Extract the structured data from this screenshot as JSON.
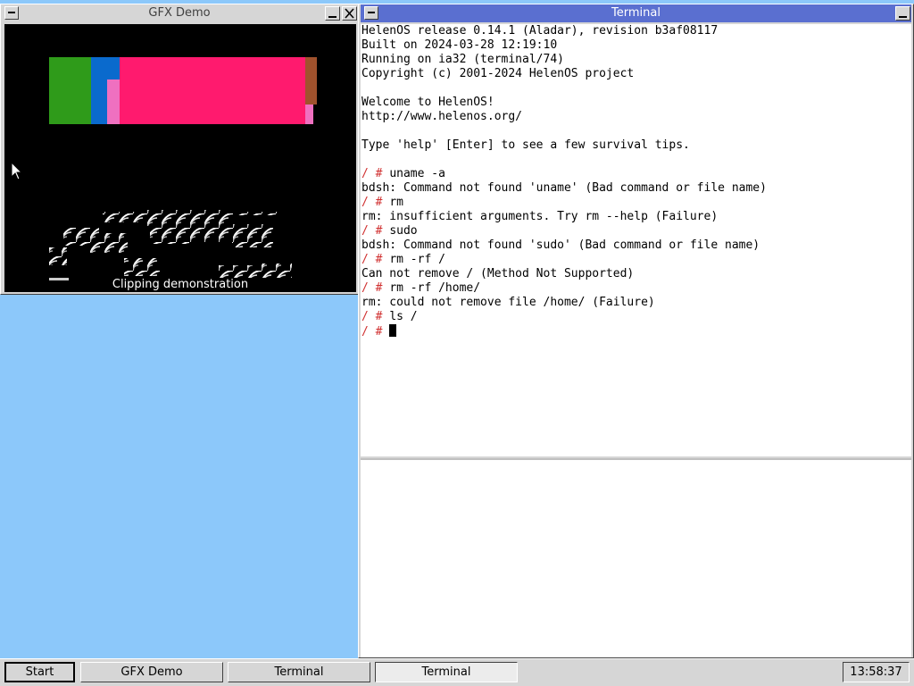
{
  "desktop": {
    "background_color": "#8cc8fa"
  },
  "gfx_window": {
    "title": "GFX Demo",
    "caption": "Clipping demonstration",
    "colors": {
      "green": "#2f9b1a",
      "blue": "#0a6acd",
      "pink": "#ff1a6e",
      "light_pink": "#ef70c0",
      "brown": "#a0522d"
    }
  },
  "terminal_window": {
    "title": "Terminal",
    "prompt": "/ #",
    "lines": [
      {
        "type": "out",
        "text": "HelenOS release 0.14.1 (Aladar), revision b3af08117"
      },
      {
        "type": "out",
        "text": "Built on 2024-03-28 12:19:10"
      },
      {
        "type": "out",
        "text": "Running on ia32 (terminal/74)"
      },
      {
        "type": "out",
        "text": "Copyright (c) 2001-2024 HelenOS project"
      },
      {
        "type": "out",
        "text": ""
      },
      {
        "type": "out",
        "text": "Welcome to HelenOS!"
      },
      {
        "type": "out",
        "text": "http://www.helenos.org/"
      },
      {
        "type": "out",
        "text": ""
      },
      {
        "type": "out",
        "text": "Type 'help' [Enter] to see a few survival tips."
      },
      {
        "type": "out",
        "text": ""
      },
      {
        "type": "cmd",
        "text": "uname -a"
      },
      {
        "type": "out",
        "text": "bdsh: Command not found 'uname' (Bad command or file name)"
      },
      {
        "type": "cmd",
        "text": "rm"
      },
      {
        "type": "out",
        "text": "rm: insufficient arguments. Try rm --help (Failure)"
      },
      {
        "type": "cmd",
        "text": "sudo"
      },
      {
        "type": "out",
        "text": "bdsh: Command not found 'sudo' (Bad command or file name)"
      },
      {
        "type": "cmd",
        "text": "rm -rf /"
      },
      {
        "type": "out",
        "text": "Can not remove / (Method Not Supported)"
      },
      {
        "type": "cmd",
        "text": "rm -rf /home/"
      },
      {
        "type": "out",
        "text": "rm: could not remove file /home/ (Failure)"
      },
      {
        "type": "cmd",
        "text": "ls /"
      },
      {
        "type": "input",
        "text": ""
      }
    ]
  },
  "taskbar": {
    "start_label": "Start",
    "tasks": [
      {
        "label": "GFX Demo",
        "active": false
      },
      {
        "label": "Terminal",
        "active": false
      },
      {
        "label": "Terminal",
        "active": true
      }
    ],
    "clock": "13:58:37"
  }
}
